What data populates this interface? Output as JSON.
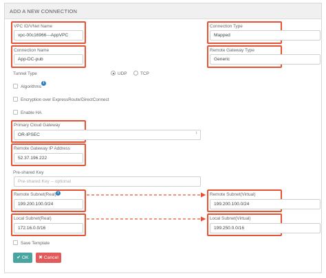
{
  "header": {
    "title": "ADD A NEW CONNECTION"
  },
  "left": {
    "vpc": {
      "label": "VPC ID/VNet Name",
      "value": "vpc-00c16966---AppVPC"
    },
    "connection_name": {
      "label": "Connection Name",
      "value": "App-DC-pub"
    },
    "tunnel_type": {
      "label": "Tunnel Type",
      "options": [
        "UDP",
        "TCP"
      ],
      "selected": "UDP"
    },
    "algorithms": {
      "label": "Algorithms"
    },
    "encryption": {
      "label": "Encryption over ExpressRoute/DirectConnect"
    },
    "enable_ha": {
      "label": "Enable HA"
    },
    "primary_gateway": {
      "label": "Primary Cloud Gateway",
      "value": "OR-IPSEC"
    },
    "remote_gateway_ip": {
      "label": "Remote Gateway IP Address",
      "value": "52.37.196.222"
    },
    "preshared_key": {
      "label": "Pre-shared Key",
      "placeholder": "Pre-shared Key -- optional"
    },
    "remote_subnet_real": {
      "label": "Remote Subnet(Real)",
      "value": "199.200.100.0/24"
    },
    "local_subnet_real": {
      "label": "Local Subnet(Real)",
      "value": "172.16.0.0/16"
    },
    "save_template": {
      "label": "Save Template"
    }
  },
  "right": {
    "connection_type": {
      "label": "Connection Type",
      "value": "Mapped"
    },
    "remote_gateway_type": {
      "label": "Remote Gateway Type",
      "value": "Generic"
    },
    "remote_subnet_virtual": {
      "label": "Remote Subnet(Virtual)",
      "value": "199.200.100.0/24"
    },
    "local_subnet_virtual": {
      "label": "Local Subnet(Virtual)",
      "value": "199.250.0.0/16"
    }
  },
  "buttons": {
    "ok": "OK",
    "cancel": "Cancel"
  },
  "icons": {
    "info": "info-icon",
    "check": "check-icon",
    "cross": "cross-icon",
    "select": "chevron-updown-icon"
  },
  "colors": {
    "highlight": "#e8502f",
    "ok": "#4aa4a0",
    "cancel": "#e25a5a",
    "info": "#2f7fc1"
  }
}
